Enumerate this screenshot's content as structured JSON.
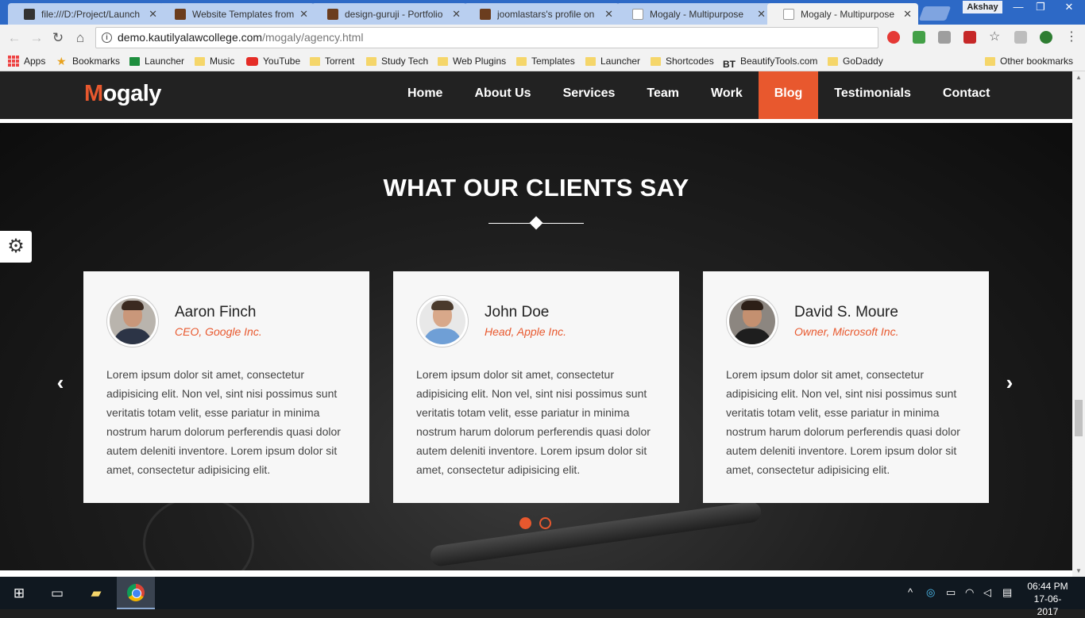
{
  "browser": {
    "tabs": [
      {
        "title": "file:///D:/Project/Launch",
        "active": false
      },
      {
        "title": "Website Templates from",
        "active": false
      },
      {
        "title": "design-guruji - Portfolio",
        "active": false
      },
      {
        "title": "joomlastars's profile on",
        "active": false
      },
      {
        "title": "Mogaly - Multipurpose",
        "active": false
      },
      {
        "title": "Mogaly - Multipurpose",
        "active": true
      }
    ],
    "profile_name": "Akshay",
    "url_host": "demo.kautilyalawcollege.com",
    "url_path": "/mogaly/agency.html",
    "bookmarks": [
      {
        "label": "Apps",
        "icon": "apps-grid-icon"
      },
      {
        "label": "Bookmarks",
        "icon": "star-icon"
      },
      {
        "label": "Launcher",
        "icon": "sheet-icon"
      },
      {
        "label": "Music",
        "icon": "folder-icon"
      },
      {
        "label": "YouTube",
        "icon": "youtube-icon"
      },
      {
        "label": "Torrent",
        "icon": "folder-icon"
      },
      {
        "label": "Study Tech",
        "icon": "folder-icon"
      },
      {
        "label": "Web Plugins",
        "icon": "folder-icon"
      },
      {
        "label": "Templates",
        "icon": "folder-icon"
      },
      {
        "label": "Launcher",
        "icon": "folder-icon"
      },
      {
        "label": "Shortcodes",
        "icon": "folder-icon"
      },
      {
        "label": "BeautifyTools.com",
        "icon": "bt-icon"
      },
      {
        "label": "GoDaddy",
        "icon": "folder-icon"
      }
    ],
    "other_bookmarks": "Other bookmarks"
  },
  "site": {
    "logo_first": "M",
    "logo_rest": "ogaly",
    "nav": [
      "Home",
      "About Us",
      "Services",
      "Team",
      "Work",
      "Blog",
      "Testimonials",
      "Contact"
    ],
    "nav_active": "Blog",
    "accent": "#e8582e"
  },
  "testimonials": {
    "heading": "WHAT OUR CLIENTS SAY",
    "cards": [
      {
        "name": "Aaron Finch",
        "role": "CEO, Google Inc.",
        "text": "Lorem ipsum dolor sit amet, consectetur adipisicing elit. Non vel, sint nisi possimus sunt veritatis totam velit, esse pariatur in minima nostrum harum dolorum perferendis quasi dolor autem deleniti inventore. Lorem ipsum dolor sit amet, consectetur adipisicing elit."
      },
      {
        "name": "John Doe",
        "role": "Head, Apple Inc.",
        "text": "Lorem ipsum dolor sit amet, consectetur adipisicing elit. Non vel, sint nisi possimus sunt veritatis totam velit, esse pariatur in minima nostrum harum dolorum perferendis quasi dolor autem deleniti inventore. Lorem ipsum dolor sit amet, consectetur adipisicing elit."
      },
      {
        "name": "David S. Moure",
        "role": "Owner, Microsoft Inc.",
        "text": "Lorem ipsum dolor sit amet, consectetur adipisicing elit. Non vel, sint nisi possimus sunt veritatis totam velit, esse pariatur in minima nostrum harum dolorum perferendis quasi dolor autem deleniti inventore. Lorem ipsum dolor sit amet, consectetur adipisicing elit."
      }
    ],
    "pager_count": 2,
    "pager_active": 0
  },
  "taskbar": {
    "time": "06:44 PM",
    "date": "17-06-2017"
  }
}
